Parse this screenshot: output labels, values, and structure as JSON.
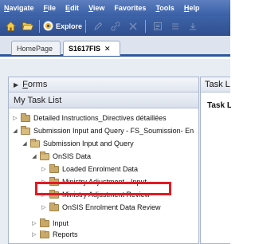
{
  "menu": {
    "items": [
      {
        "mnemonic": "N",
        "rest": "avigate"
      },
      {
        "mnemonic": "F",
        "rest": "ile"
      },
      {
        "mnemonic": "E",
        "rest": "dit"
      },
      {
        "mnemonic": "V",
        "rest": "iew"
      },
      {
        "mnemonic": "",
        "rest": "Favorites"
      },
      {
        "mnemonic": "T",
        "rest": "ools"
      },
      {
        "mnemonic": "H",
        "rest": "elp"
      }
    ]
  },
  "toolbar": {
    "explore_label": "Explore",
    "icons": [
      "home-icon",
      "folder-open-icon",
      "explore-icon",
      "edit-icon",
      "link-icon",
      "delete-icon",
      "properties-icon"
    ]
  },
  "tabs": [
    {
      "label": "HomePage"
    },
    {
      "label": "S1617FIS",
      "close": "✕"
    }
  ],
  "forms_panel": {
    "prefix": "F",
    "rest": "orms"
  },
  "my_task_list": {
    "title": "My Task List"
  },
  "tree": [
    {
      "label": "Detailed Instructions_Directives détaillées"
    },
    {
      "label": "Submission Input and Query - FS_Soumission- En"
    },
    {
      "label": "Submission Input and Query"
    },
    {
      "label": "OnSIS Data"
    },
    {
      "label": "Loaded Enrolment Data"
    },
    {
      "label": "Ministry Adjustment - Input"
    },
    {
      "label": "Ministry Adjustment Review"
    },
    {
      "label": "OnSIS Enrolment Data Review"
    },
    {
      "label": "Input"
    },
    {
      "label": "Reports"
    }
  ],
  "right_panel": {
    "header": "Task Li",
    "sub": "Task L"
  },
  "colors": {
    "menubar": "#3a5fa6",
    "highlight": "#e21a23"
  }
}
